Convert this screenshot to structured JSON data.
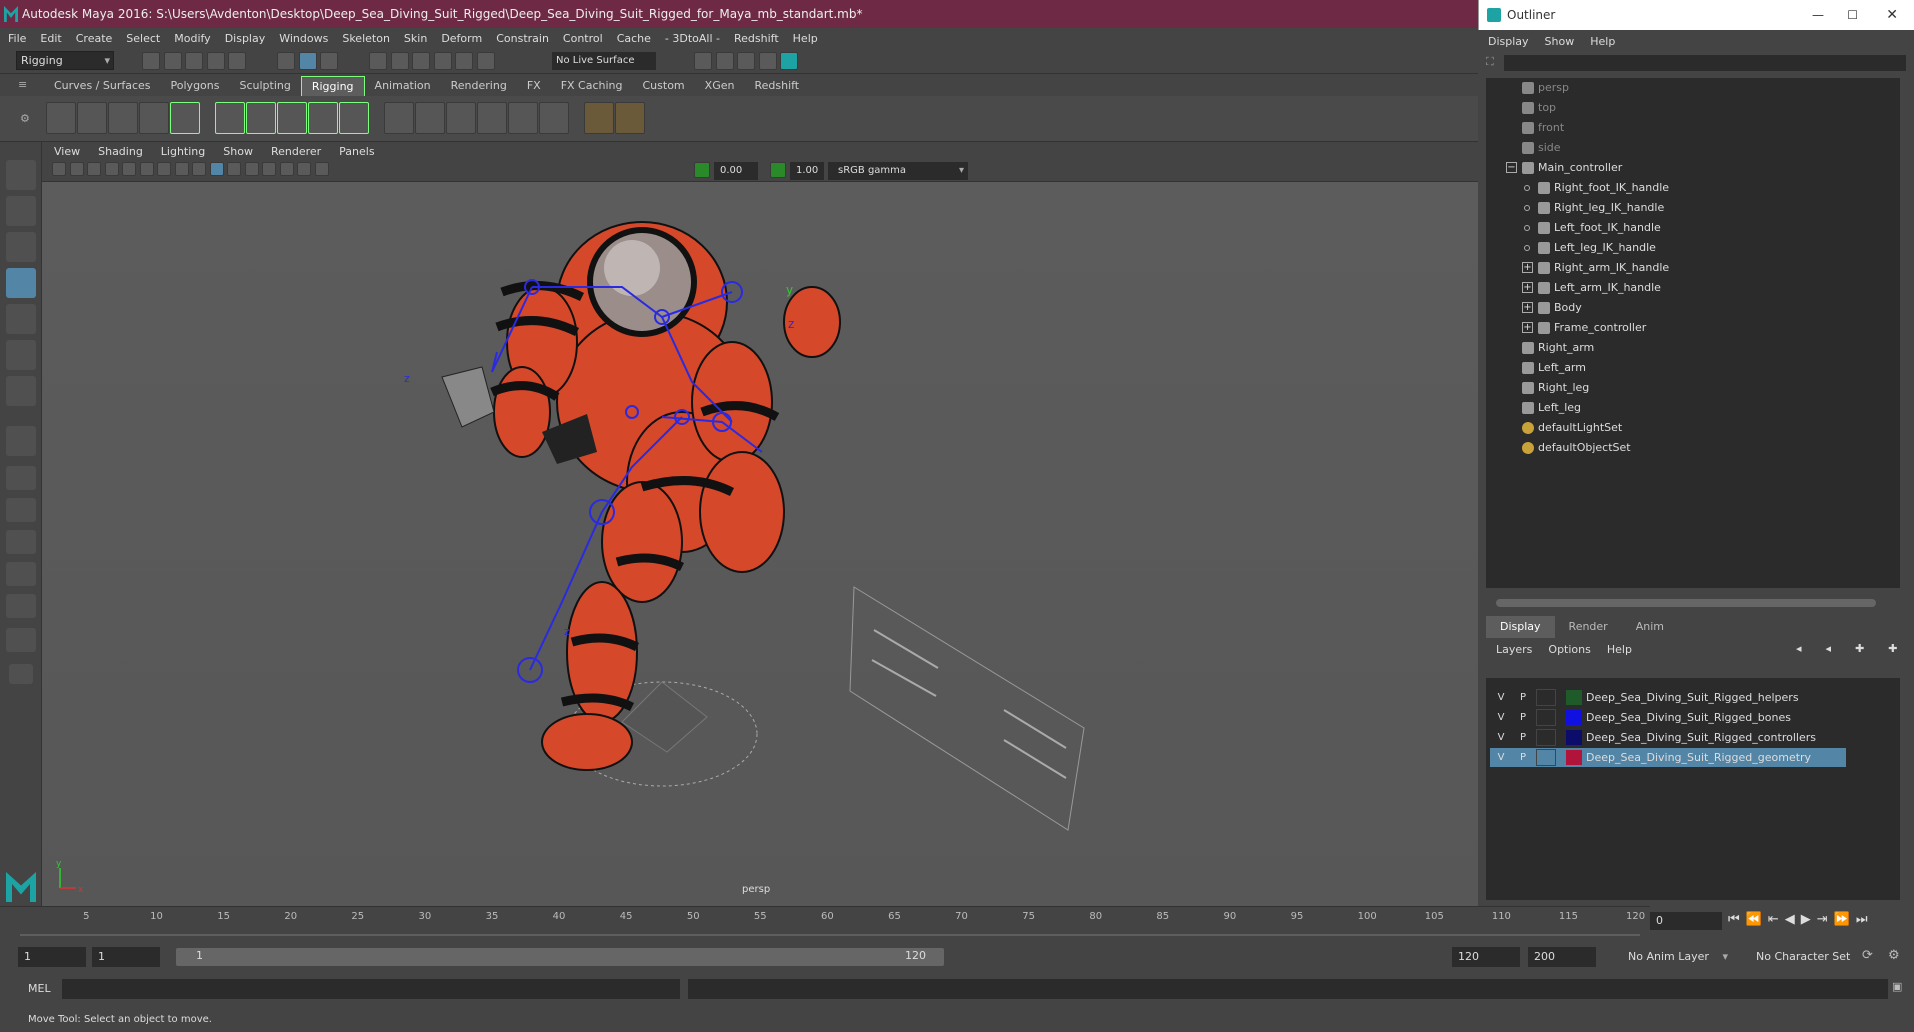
{
  "app": {
    "title": "Autodesk Maya 2016: S:\\Users\\Avdenton\\Desktop\\Deep_Sea_Diving_Suit_Rigged\\Deep_Sea_Diving_Suit_Rigged_for_Maya_mb_standart.mb*"
  },
  "menubar": [
    "File",
    "Edit",
    "Create",
    "Select",
    "Modify",
    "Display",
    "Windows",
    "Skeleton",
    "Skin",
    "Deform",
    "Constrain",
    "Control",
    "Cache",
    "- 3DtoAll -",
    "Redshift",
    "Help"
  ],
  "statusline": {
    "mode": "Rigging",
    "live_surface": "No Live Surface"
  },
  "shelf_tabs": [
    {
      "label": "Curves / Surfaces",
      "active": false
    },
    {
      "label": "Polygons",
      "active": false
    },
    {
      "label": "Sculpting",
      "active": false
    },
    {
      "label": "Rigging",
      "active": true
    },
    {
      "label": "Animation",
      "active": false
    },
    {
      "label": "Rendering",
      "active": false
    },
    {
      "label": "FX",
      "active": false
    },
    {
      "label": "FX Caching",
      "active": false
    },
    {
      "label": "Custom",
      "active": false
    },
    {
      "label": "XGen",
      "active": false
    },
    {
      "label": "Redshift",
      "active": false
    }
  ],
  "viewport": {
    "menu": [
      "View",
      "Shading",
      "Lighting",
      "Show",
      "Renderer",
      "Panels"
    ],
    "exposure": "0.00",
    "gamma_value": "1.00",
    "color_space": "sRGB gamma",
    "camera_label": "persp",
    "axis_y": "y",
    "axis_z": "z",
    "axis_x": "x"
  },
  "outliner": {
    "title": "Outliner",
    "menu": [
      "Display",
      "Show",
      "Help"
    ],
    "items": [
      {
        "label": "persp",
        "indent": 0,
        "dim": true,
        "expander": ""
      },
      {
        "label": "top",
        "indent": 0,
        "dim": true,
        "expander": ""
      },
      {
        "label": "front",
        "indent": 0,
        "dim": true,
        "expander": ""
      },
      {
        "label": "side",
        "indent": 0,
        "dim": true,
        "expander": ""
      },
      {
        "label": "Main_controller",
        "indent": 0,
        "dim": false,
        "expander": "−"
      },
      {
        "label": "Right_foot_IK_handle",
        "indent": 1,
        "dim": false,
        "expander": ""
      },
      {
        "label": "Right_leg_IK_handle",
        "indent": 1,
        "dim": false,
        "expander": ""
      },
      {
        "label": "Left_foot_IK_handle",
        "indent": 1,
        "dim": false,
        "expander": ""
      },
      {
        "label": "Left_leg_IK_handle",
        "indent": 1,
        "dim": false,
        "expander": ""
      },
      {
        "label": "Right_arm_IK_handle",
        "indent": 1,
        "dim": false,
        "expander": "+"
      },
      {
        "label": "Left_arm_IK_handle",
        "indent": 1,
        "dim": false,
        "expander": "+"
      },
      {
        "label": "Body",
        "indent": 1,
        "dim": false,
        "expander": "+"
      },
      {
        "label": "Frame_controller",
        "indent": 1,
        "dim": false,
        "expander": "+"
      },
      {
        "label": "Right_arm",
        "indent": 0,
        "dim": false,
        "expander": ""
      },
      {
        "label": "Left_arm",
        "indent": 0,
        "dim": false,
        "expander": ""
      },
      {
        "label": "Right_leg",
        "indent": 0,
        "dim": false,
        "expander": ""
      },
      {
        "label": "Left_leg",
        "indent": 0,
        "dim": false,
        "expander": ""
      },
      {
        "label": "defaultLightSet",
        "indent": 0,
        "dim": false,
        "expander": ""
      },
      {
        "label": "defaultObjectSet",
        "indent": 0,
        "dim": false,
        "expander": ""
      }
    ]
  },
  "layers": {
    "tabs": [
      {
        "label": "Display",
        "active": true
      },
      {
        "label": "Render",
        "active": false
      },
      {
        "label": "Anim",
        "active": false
      }
    ],
    "menu": [
      "Layers",
      "Options",
      "Help"
    ],
    "rows": [
      {
        "v": "V",
        "p": "P",
        "color": "#1f5a2a",
        "name": "Deep_Sea_Diving_Suit_Rigged_helpers",
        "selected": false
      },
      {
        "v": "V",
        "p": "P",
        "color": "#1010e0",
        "name": "Deep_Sea_Diving_Suit_Rigged_bones",
        "selected": false
      },
      {
        "v": "V",
        "p": "P",
        "color": "#0c0c6a",
        "name": "Deep_Sea_Diving_Suit_Rigged_controllers",
        "selected": false
      },
      {
        "v": "V",
        "p": "P",
        "color": "#b0143a",
        "name": "Deep_Sea_Diving_Suit_Rigged_geometry",
        "selected": true
      }
    ]
  },
  "timeline": {
    "ticks": [
      "5",
      "10",
      "15",
      "20",
      "25",
      "30",
      "35",
      "40",
      "45",
      "50",
      "55",
      "60",
      "65",
      "70",
      "75",
      "80",
      "85",
      "90",
      "95",
      "100",
      "105",
      "110",
      "115",
      "120"
    ],
    "current_frame": "0",
    "range_start": "1",
    "playback_start": "1",
    "range_slider_start": "1",
    "range_slider_end": "120",
    "playback_end": "120",
    "range_end": "200",
    "anim_layer": "No Anim Layer",
    "character_set": "No Character Set"
  },
  "cmdline": {
    "label": "MEL"
  },
  "helpline": {
    "text": "Move Tool: Select an object to move."
  },
  "colors": {
    "suit": "#d5482a",
    "bones": "#2a2ae0",
    "accent": "#5285a6"
  }
}
